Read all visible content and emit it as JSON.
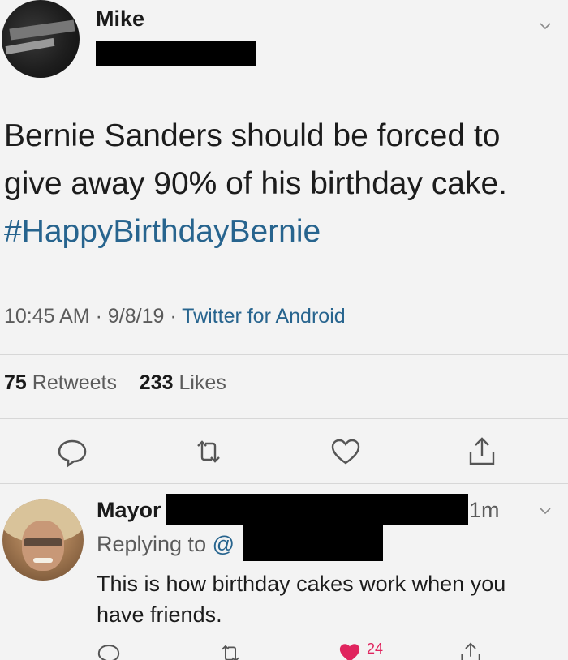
{
  "tweet": {
    "author_name": "Mike",
    "text": "Bernie Sanders should be forced to give away 90% of his birthday cake.",
    "hashtag": "#HappyBirthdayBernie",
    "time": "10:45 AM",
    "date": "9/8/19",
    "source": "Twitter for Android",
    "retweets_count": "75",
    "retweets_label": "Retweets",
    "likes_count": "233",
    "likes_label": "Likes"
  },
  "reply": {
    "author_name": "Mayor",
    "time": "1m",
    "replying_prefix": "Replying to",
    "replying_at": "@",
    "text": "This is how birthday cakes work when you have friends.",
    "likes_count": "24"
  },
  "colors": {
    "link": "#27648e",
    "like": "#e0245e",
    "muted": "#5b5b5b",
    "background": "#f3f3f3"
  },
  "icons": [
    "reply-icon",
    "retweet-icon",
    "like-icon",
    "share-icon",
    "chevron-down-icon"
  ]
}
